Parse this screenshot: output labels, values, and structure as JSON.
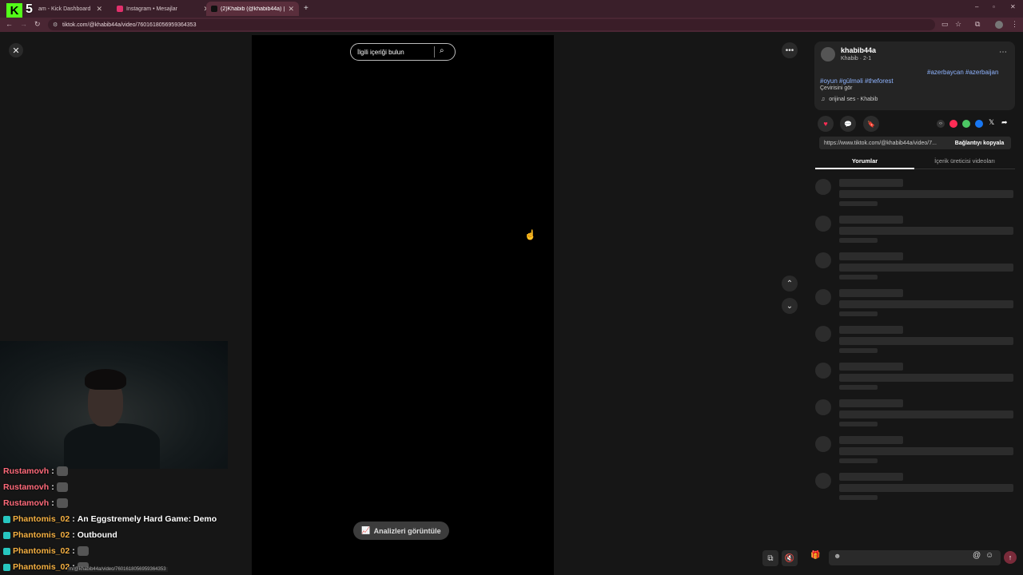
{
  "browser": {
    "tabs": [
      {
        "label": "am - Kick Dashboard",
        "color": "#53fc18",
        "active": false
      },
      {
        "label": "Instagram • Mesajlar",
        "color": "#e1306c",
        "active": false
      },
      {
        "label": "(2)Khabib (@khabib44a) | TikTo",
        "color": "#111111",
        "active": true
      }
    ],
    "url": "tiktok.com/@khabib44a/video/7601618056959364353",
    "new_tab": "+"
  },
  "overlay": {
    "kick_number": "5",
    "kick_letter": "K"
  },
  "video": {
    "search_placeholder": "İlgili içeriği bulun",
    "analytics_label": "Analizleri görüntüle"
  },
  "post": {
    "username": "khabib44a",
    "subline": "Khabib · 2-1",
    "hashtags_line1": "#azerbaycan #azerbaijan",
    "hashtags_line2": "#oyun #gülməli #theforest",
    "see_translation": "Çevirisini gör",
    "sound": "orijinal ses - Khabib",
    "link": "https://www.tiktok.com/@khabib44a/video/7...",
    "copy_link": "Bağlantıyı kopyala",
    "tab_comments": "Yorumlar",
    "tab_creator_videos": "İçerik üreticisi videoları"
  },
  "chat": [
    {
      "user": "Rustamovh",
      "sep": ":",
      "message": "",
      "color": "red",
      "badge": false
    },
    {
      "user": "Rustamovh",
      "sep": ":",
      "message": "",
      "color": "red",
      "badge": false
    },
    {
      "user": "Rustamovh",
      "sep": ":",
      "message": "",
      "color": "red",
      "badge": false
    },
    {
      "user": "Phantomis_02",
      "sep": ":",
      "message": "An Eggstremely Hard Game: Demo",
      "color": "yellow",
      "badge": true
    },
    {
      "user": "Phantomis_02",
      "sep": ":",
      "message": "Outbound",
      "color": "yellow",
      "badge": true
    },
    {
      "user": "Phantomis_02",
      "sep": ":",
      "message": "",
      "color": "yellow",
      "badge": true
    },
    {
      "user": "Phantomis_02",
      "sep": ":",
      "message": "",
      "color": "yellow",
      "badge": true
    }
  ],
  "status_url": "m/@khabib44a/video/7601618056959364353",
  "icons": {
    "close": "close-icon",
    "more": "more-icon",
    "up": "chevron-up-icon",
    "down": "chevron-down-icon"
  }
}
